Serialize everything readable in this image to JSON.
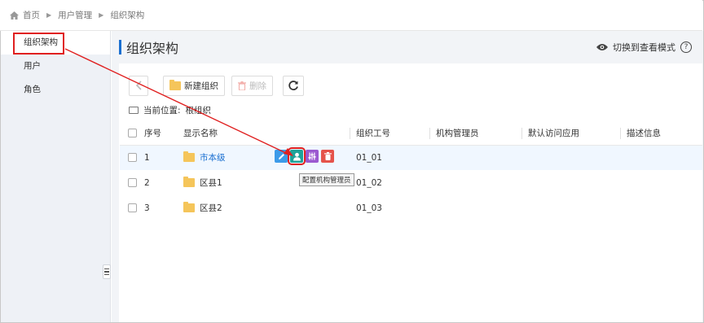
{
  "breadcrumb": {
    "home": "首页",
    "level1": "用户管理",
    "level2": "组织架构"
  },
  "sidebar": {
    "items": [
      {
        "label": "组织架构"
      },
      {
        "label": "用户"
      },
      {
        "label": "角色"
      }
    ]
  },
  "page": {
    "title": "组织架构",
    "view_mode": "切换到查看模式",
    "help": "?"
  },
  "toolbar": {
    "new_org": "新建组织",
    "delete": "删除"
  },
  "location": {
    "label": "当前位置:",
    "value": "根组织"
  },
  "table": {
    "headers": {
      "no": "序号",
      "name": "显示名称",
      "code": "组织工号",
      "manager": "机构管理员",
      "app": "默认访问应用",
      "desc": "描述信息"
    },
    "rows": [
      {
        "no": "1",
        "name": "市本级",
        "code": "01_01"
      },
      {
        "no": "2",
        "name": "区县1",
        "code": "01_02"
      },
      {
        "no": "3",
        "name": "区县2",
        "code": "01_03"
      }
    ]
  },
  "tooltip": "配置机构管理员",
  "icons": {
    "home": "home-icon",
    "eye": "eye-icon",
    "refresh": "refresh-icon",
    "folder": "folder-icon",
    "edit": "edit-icon",
    "manager": "user-config-icon",
    "settings": "sliders-icon",
    "trash": "trash-icon"
  },
  "colors": {
    "accent": "#1a6fd0",
    "highlight": "#e02020",
    "folder": "#f5c55a",
    "delete": "#e5534b",
    "config": "#1fa39a",
    "settings": "#9b59d0",
    "edit": "#3d9be9"
  }
}
